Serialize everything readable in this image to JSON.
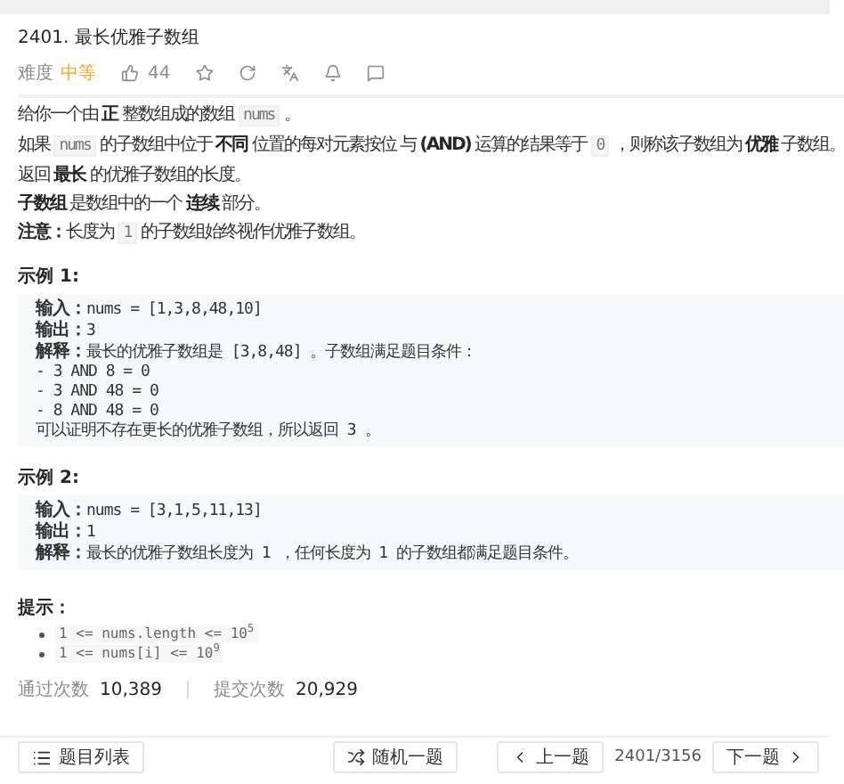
{
  "title": "2401. 最长优雅子数组",
  "meta": {
    "difficulty_label": "难度",
    "difficulty": "中等",
    "likes": "44"
  },
  "description": [
    [
      {
        "kind": "text",
        "text": "给你一个由 "
      },
      {
        "kind": "bold",
        "text": "正"
      },
      {
        "kind": "text",
        "text": " 整数组成的数组 "
      },
      {
        "kind": "code",
        "text": "nums"
      },
      {
        "kind": "text",
        "text": " 。"
      }
    ],
    [
      {
        "kind": "text",
        "text": "如果 "
      },
      {
        "kind": "code",
        "text": "nums"
      },
      {
        "kind": "text",
        "text": " 的子数组中位于 "
      },
      {
        "kind": "bold",
        "text": "不同"
      },
      {
        "kind": "text",
        "text": " 位置的每对元素按位 与 "
      },
      {
        "kind": "bold",
        "text": "(AND)"
      },
      {
        "kind": "text",
        "text": " 运算的结果等于 "
      },
      {
        "kind": "code",
        "text": "0"
      },
      {
        "kind": "text",
        "text": " ，则称该子数组为 "
      },
      {
        "kind": "bold",
        "text": "优雅"
      },
      {
        "kind": "text",
        "text": " 子数组。"
      }
    ],
    [
      {
        "kind": "text",
        "text": "返回 "
      },
      {
        "kind": "bold",
        "text": "最长"
      },
      {
        "kind": "text",
        "text": " 的优雅子数组的长度。"
      }
    ],
    [
      {
        "kind": "bold",
        "text": "子数组"
      },
      {
        "kind": "text",
        "text": " 是数组中的一个 "
      },
      {
        "kind": "bold",
        "text": "连续"
      },
      {
        "kind": "text",
        "text": " 部分。"
      }
    ],
    [
      {
        "kind": "bold",
        "text": "注意："
      },
      {
        "kind": "text",
        "text": "长度为 "
      },
      {
        "kind": "code",
        "text": "1"
      },
      {
        "kind": "text",
        "text": " 的子数组始终视作优雅子数组。"
      }
    ]
  ],
  "examples": [
    {
      "heading": "示例 1:",
      "lines": [
        "**输入：**nums = [1,3,8,48,10]",
        "**输出：**3",
        "**解释：**最长的优雅子数组是 [3,8,48] 。子数组满足题目条件：",
        "- 3 AND 8 = 0",
        "- 3 AND 48 = 0",
        "- 8 AND 48 = 0",
        "可以证明不存在更长的优雅子数组，所以返回 3 。"
      ]
    },
    {
      "heading": "示例 2:",
      "lines": [
        "**输入：**nums = [3,1,5,11,13]",
        "**输出：**1",
        "**解释：**最长的优雅子数组长度为 1 ，任何长度为 1 的子数组都满足题目条件。"
      ]
    }
  ],
  "hints_heading": "提示：",
  "hints": [
    "1 <= nums.length <= 10$^{5}$",
    "1 <= nums[i] <= 10$^{9}$"
  ],
  "stats": [
    {
      "label": "通过次数",
      "value": "10,389"
    },
    {
      "label": "提交次数",
      "value": "20,929"
    }
  ],
  "footer": {
    "list_button": "题目列表",
    "random_button": "随机一题",
    "prev_button": "上一题",
    "position": "2401/3156",
    "next_button": "下一题"
  }
}
